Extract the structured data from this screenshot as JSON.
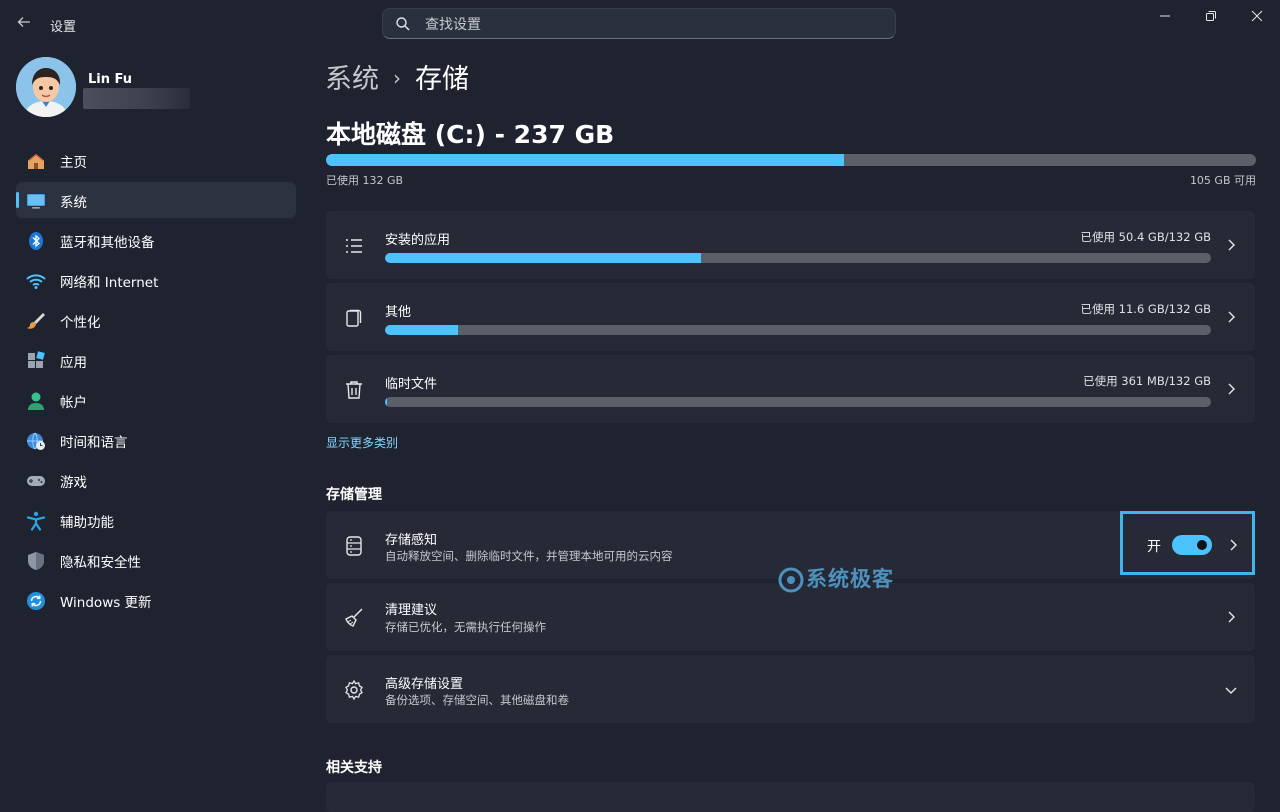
{
  "window": {
    "title": "设置",
    "back_icon": "back-arrow-icon",
    "controls": [
      "minimize-icon",
      "restore-icon",
      "close-icon"
    ]
  },
  "search": {
    "placeholder": "查找设置",
    "icon": "search-icon"
  },
  "user": {
    "name": "Lin Fu",
    "email": ""
  },
  "sidebar": {
    "items": [
      {
        "label": "主页",
        "icon": "home-icon",
        "active": false
      },
      {
        "label": "系统",
        "icon": "system-display-icon",
        "active": true
      },
      {
        "label": "蓝牙和其他设备",
        "icon": "bluetooth-icon",
        "active": false
      },
      {
        "label": "网络和 Internet",
        "icon": "wifi-icon",
        "active": false
      },
      {
        "label": "个性化",
        "icon": "paintbrush-icon",
        "active": false
      },
      {
        "label": "应用",
        "icon": "apps-icon",
        "active": false
      },
      {
        "label": "帐户",
        "icon": "account-icon",
        "active": false
      },
      {
        "label": "时间和语言",
        "icon": "globe-clock-icon",
        "active": false
      },
      {
        "label": "游戏",
        "icon": "gamepad-icon",
        "active": false
      },
      {
        "label": "辅助功能",
        "icon": "accessibility-icon",
        "active": false
      },
      {
        "label": "隐私和安全性",
        "icon": "shield-icon",
        "active": false
      },
      {
        "label": "Windows 更新",
        "icon": "update-icon",
        "active": false
      }
    ]
  },
  "breadcrumb": {
    "parent": "系统",
    "separator": "›",
    "current": "存储"
  },
  "drive": {
    "title": "本地磁盘 (C:) - 237 GB",
    "used_label": "已使用 132 GB",
    "free_label": "105 GB 可用",
    "used_fraction": 0.557
  },
  "categories": [
    {
      "title": "安装的应用",
      "used": "已使用 50.4 GB/132 GB",
      "fraction": 0.382,
      "icon": "list-icon"
    },
    {
      "title": "其他",
      "used": "已使用 11.6 GB/132 GB",
      "fraction": 0.088,
      "icon": "documents-icon"
    },
    {
      "title": "临时文件",
      "used": "已使用 361 MB/132 GB",
      "fraction": 0.003,
      "icon": "trash-icon"
    }
  ],
  "show_more": "显示更多类别",
  "storage_management": {
    "heading": "存储管理",
    "items": [
      {
        "title": "存储感知",
        "subtitle": "自动释放空间、删除临时文件，并管理本地可用的云内容",
        "icon": "storage-sense-icon",
        "toggle_label": "开",
        "toggle_on": true
      },
      {
        "title": "清理建议",
        "subtitle": "存储已优化，无需执行任何操作",
        "icon": "broom-icon"
      },
      {
        "title": "高级存储设置",
        "subtitle": "备份选项、存储空间、其他磁盘和卷",
        "icon": "gear-icon"
      }
    ]
  },
  "related": {
    "heading": "相关支持"
  },
  "watermark": {
    "text": "系统极客"
  },
  "colors": {
    "accent": "#4cc2ff",
    "background": "#1f2330",
    "card": "#262a37",
    "highlight_border": "#40b6ec"
  }
}
